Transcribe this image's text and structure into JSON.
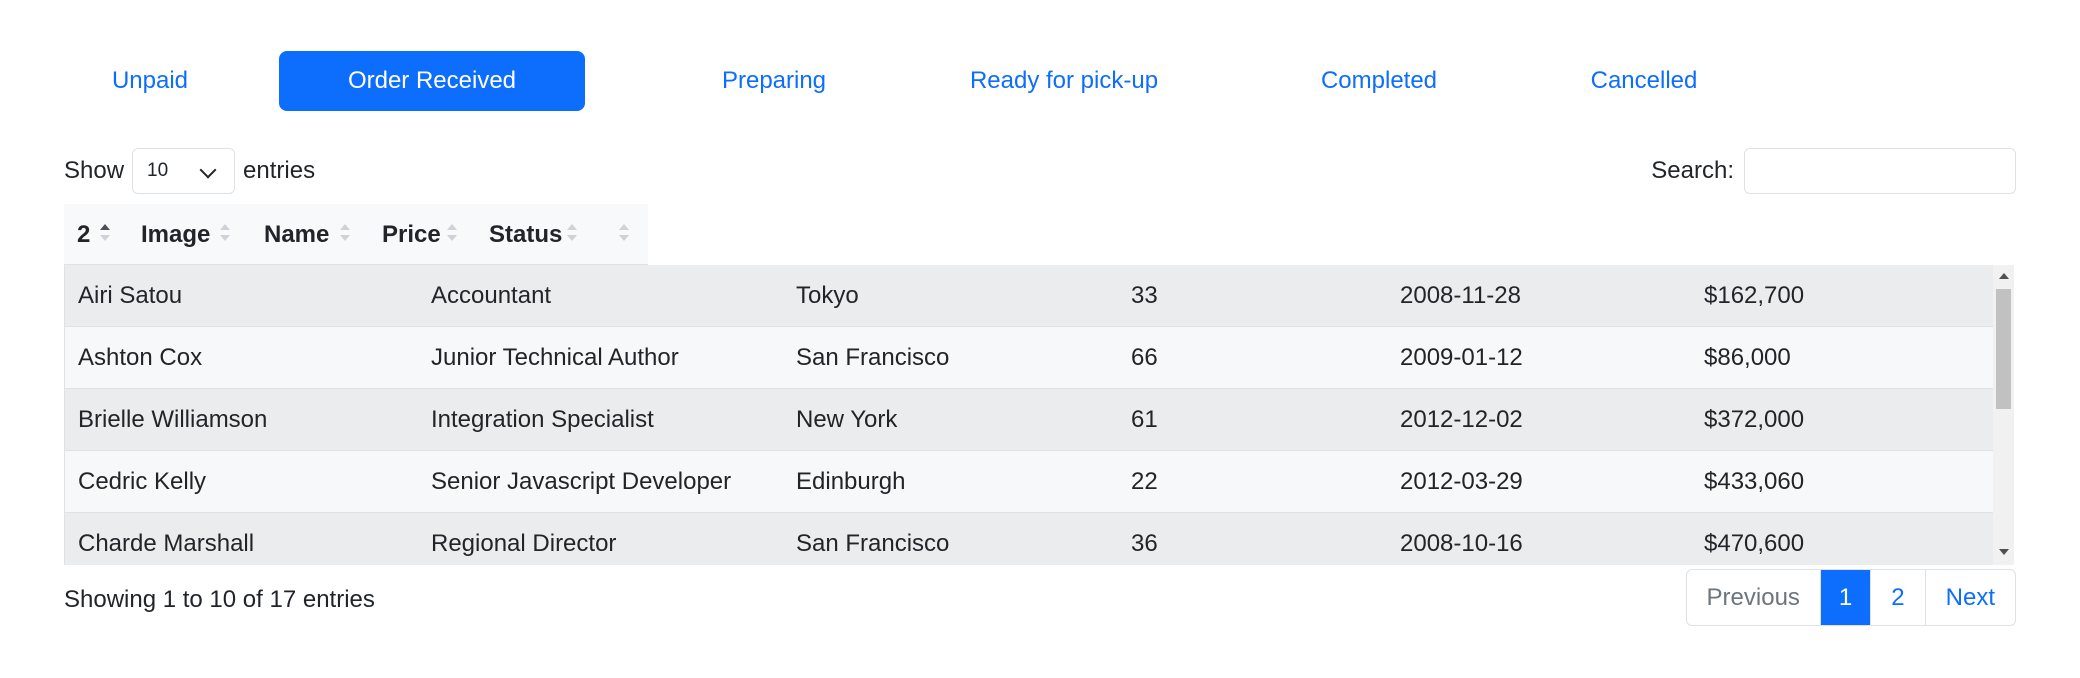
{
  "tabs": [
    {
      "label": "Unpaid"
    },
    {
      "label": "Order Received"
    },
    {
      "label": "Preparing"
    },
    {
      "label": "Ready for pick-up"
    },
    {
      "label": "Completed"
    },
    {
      "label": "Cancelled"
    }
  ],
  "active_tab": "Order Received",
  "length": {
    "show_label": "Show",
    "selected": "10",
    "entries_label": "entries"
  },
  "search": {
    "label": "Search:",
    "value": ""
  },
  "columns": [
    {
      "label": "2",
      "sort": "asc"
    },
    {
      "label": "Image",
      "sort": "none"
    },
    {
      "label": "Name",
      "sort": "none"
    },
    {
      "label": "Price",
      "sort": "none"
    },
    {
      "label": "Status",
      "sort": "none"
    },
    {
      "label": "",
      "sort": "none"
    }
  ],
  "rows": [
    {
      "c1": "Airi Satou",
      "c2": "Accountant",
      "c3": "Tokyo",
      "c4": "33",
      "c5": "2008-11-28",
      "c6": "$162,700"
    },
    {
      "c1": "Ashton Cox",
      "c2": "Junior Technical Author",
      "c3": "San Francisco",
      "c4": "66",
      "c5": "2009-01-12",
      "c6": "$86,000"
    },
    {
      "c1": "Brielle Williamson",
      "c2": "Integration Specialist",
      "c3": "New York",
      "c4": "61",
      "c5": "2012-12-02",
      "c6": "$372,000"
    },
    {
      "c1": "Cedric Kelly",
      "c2": "Senior Javascript Developer",
      "c3": "Edinburgh",
      "c4": "22",
      "c5": "2012-03-29",
      "c6": "$433,060"
    },
    {
      "c1": "Charde Marshall",
      "c2": "Regional Director",
      "c3": "San Francisco",
      "c4": "36",
      "c5": "2008-10-16",
      "c6": "$470,600"
    }
  ],
  "info": "Showing 1 to 10 of 17 entries",
  "pagination": {
    "previous": "Previous",
    "pages": [
      "1",
      "2"
    ],
    "current": "1",
    "next": "Next"
  },
  "colors": {
    "accent": "#0d6efd",
    "row_odd": "#ebecee",
    "row_even": "#f7f8f9",
    "header_bg": "#f8f9fa"
  }
}
